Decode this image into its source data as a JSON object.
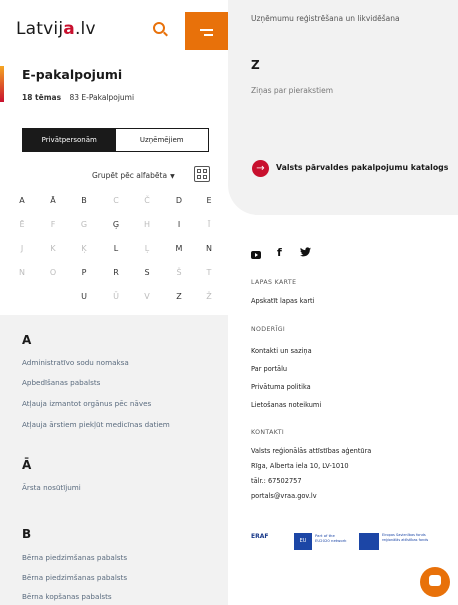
{
  "header": {
    "logo_prefix": "Latvij",
    "logo_mark": "a",
    "logo_suffix": ".lv"
  },
  "title": "E-pakalpojumi",
  "meta": {
    "topics": "18 tēmas",
    "services": "83 E-Pakalpojumi"
  },
  "segment": {
    "private": "Privātpersonām",
    "business": "Uzņēmējiem"
  },
  "group_by": {
    "label": "Grupēt pēc alfabēta",
    "chevron": "▼"
  },
  "alphabet": [
    [
      {
        "c": "A",
        "on": true
      },
      {
        "c": "Ā",
        "on": true
      },
      {
        "c": "B",
        "on": true
      },
      {
        "c": "C",
        "on": false
      },
      {
        "c": "Č",
        "on": false
      },
      {
        "c": "D",
        "on": true
      },
      {
        "c": "E",
        "on": true
      }
    ],
    [
      {
        "c": "Ē",
        "on": false
      },
      {
        "c": "F",
        "on": false
      },
      {
        "c": "G",
        "on": false
      },
      {
        "c": "Ģ",
        "on": true
      },
      {
        "c": "H",
        "on": false
      },
      {
        "c": "I",
        "on": true
      },
      {
        "c": "Ī",
        "on": false
      }
    ],
    [
      {
        "c": "J",
        "on": false
      },
      {
        "c": "K",
        "on": false
      },
      {
        "c": "Ķ",
        "on": false
      },
      {
        "c": "L",
        "on": true
      },
      {
        "c": "Ļ",
        "on": false
      },
      {
        "c": "M",
        "on": true
      },
      {
        "c": "N",
        "on": true
      }
    ],
    [
      {
        "c": "N",
        "on": false
      },
      {
        "c": "O",
        "on": false
      },
      {
        "c": "P",
        "on": true
      },
      {
        "c": "R",
        "on": true
      },
      {
        "c": "S",
        "on": true
      },
      {
        "c": "Š",
        "on": false
      },
      {
        "c": "T",
        "on": false
      }
    ],
    [
      {
        "c": "U",
        "on": true
      },
      {
        "c": "Ū",
        "on": false
      },
      {
        "c": "V",
        "on": false
      },
      {
        "c": "Z",
        "on": true
      },
      {
        "c": "Ž",
        "on": false
      }
    ]
  ],
  "sections": [
    {
      "letter": "A",
      "items": [
        "Administratīvo sodu nomaksa",
        "Apbedīšanas pabalsts",
        "Atļauja izmantot orgānus pēc nāves",
        "Atļauja ārstiem piekļūt medicīnas datiem"
      ]
    },
    {
      "letter": "Ā",
      "items": [
        "Ārsta nosūtījumi"
      ]
    },
    {
      "letter": "B",
      "items": [
        "Bērna piedzimšanas pabalsts",
        "Bērna piedzimšanas pabalsts",
        "Bērna kopšanas pabalsts"
      ]
    }
  ],
  "right": {
    "text1": "Uzņēmumu reģistrēšana un likvidēšana",
    "z_letter": "Z",
    "text2": "Ziņas par pierakstiem",
    "catalog_icon": "→",
    "catalog_link": "Valsts pārvaldes pakalpojumu katalogs"
  },
  "social": {
    "facebook": "f",
    "twitter": "🐦"
  },
  "footer": {
    "sitemap_h": "LAPAS KARTE",
    "sitemap_link": "Apskatīt lapas karti",
    "useful_h": "NODERĪGI",
    "useful_links": [
      "Kontakti un saziņa",
      "Par portālu",
      "Privātuma politika",
      "Lietošanas noteikumi"
    ],
    "contacts_h": "KONTAKTI",
    "contacts": [
      "Valsts reģionālās attīstības aģentūra",
      "Rīga, Alberta iela 10, LV-1010",
      "tālr.: 67502757",
      "portals@vraa.gov.lv"
    ]
  },
  "logos": {
    "eraf": "ERAF",
    "eu_box": "EU",
    "eu_text": "Part of the EU2020 network",
    "eu2_text": "Eiropas Savienības fonds reģionālās attīstības fonds"
  },
  "colors": {
    "accent": "#e8710a",
    "brand_red": "#c8102e",
    "link": "#5a6b7e"
  }
}
